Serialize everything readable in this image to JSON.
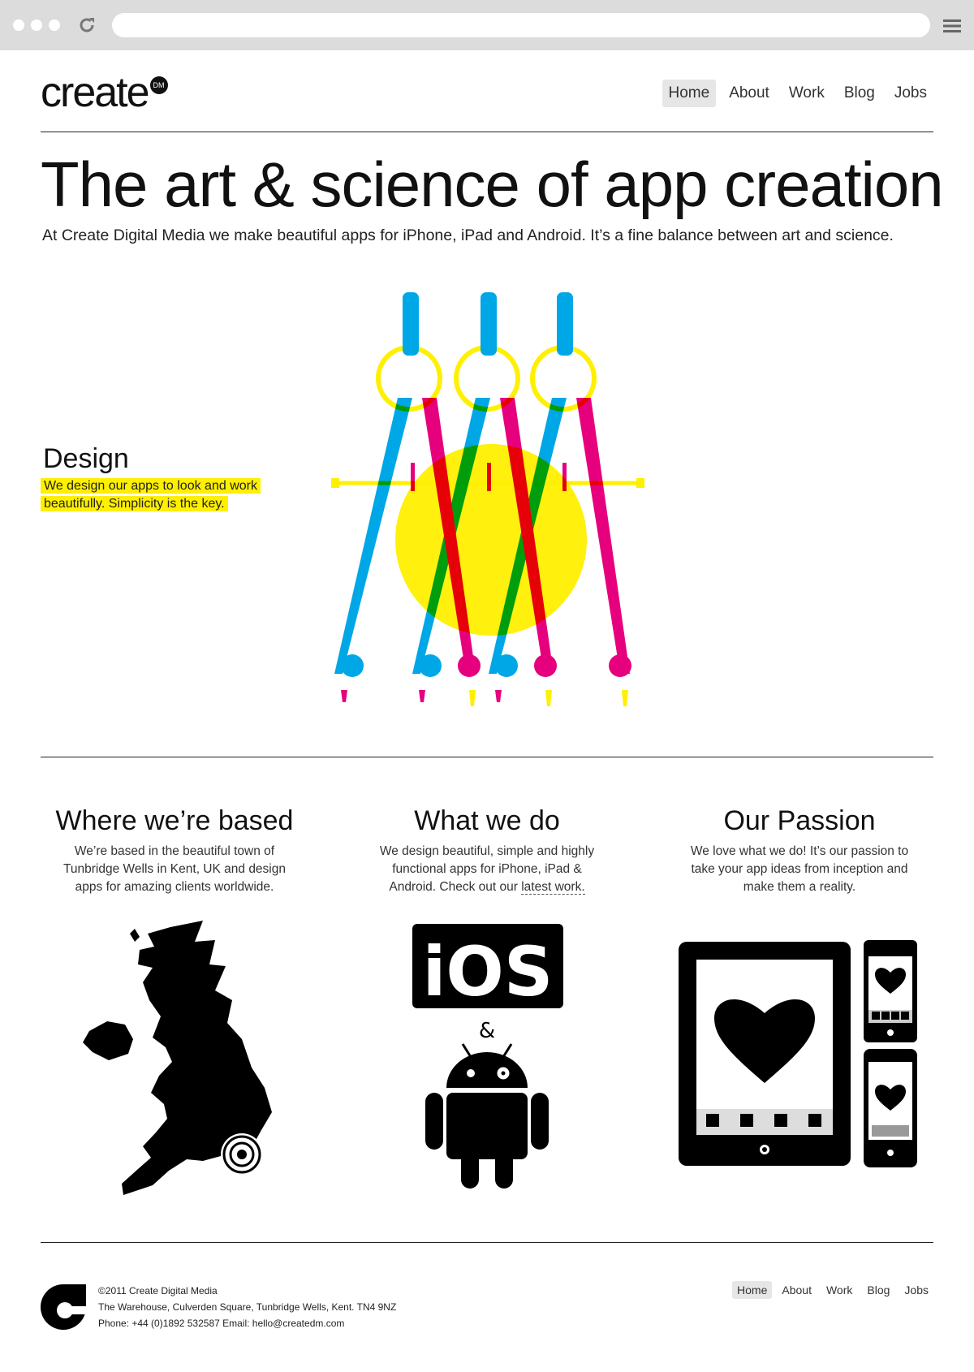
{
  "browser": {
    "url": ""
  },
  "brand": {
    "logo_text": "create",
    "logo_badge": "DM"
  },
  "nav": [
    {
      "label": "Home",
      "active": true
    },
    {
      "label": "About",
      "active": false
    },
    {
      "label": "Work",
      "active": false
    },
    {
      "label": "Blog",
      "active": false
    },
    {
      "label": "Jobs",
      "active": false
    }
  ],
  "hero": {
    "title": "The art & science of app creation",
    "subtitle": "At Create Digital Media we make beautiful apps for iPhone, iPad and Android.  It’s a fine balance between art and science."
  },
  "design": {
    "title": "Design",
    "text": "We design our apps to look and work beautifully.  Simplicity is the key."
  },
  "columns": [
    {
      "title": "Where we’re based",
      "text": "We’re based in the beautiful town of Tunbridge Wells in Kent, UK and design apps for amazing clients worldwide."
    },
    {
      "title": "What we do",
      "text": "We design beautiful, simple and highly functional apps for iPhone, iPad & Android. Check out our",
      "link": "latest work."
    },
    {
      "title": "Our Passion",
      "text": "We love what we do! It’s our passion to take your app ideas from inception and make them a reality."
    }
  ],
  "icons": {
    "ios_label": "iOS",
    "ampersand": "&"
  },
  "footer": {
    "copyright": "©2011 Create Digital Media",
    "address": "The Warehouse, Culverden Square, Tunbridge Wells, Kent. TN4 9NZ",
    "contact": "Phone: +44 (0)1892 532587   Email: hello@createdm.com"
  },
  "colors": {
    "cyan": "#00a7e6",
    "magenta": "#e6007e",
    "yellow": "#ffef00",
    "dark": "#111111"
  }
}
